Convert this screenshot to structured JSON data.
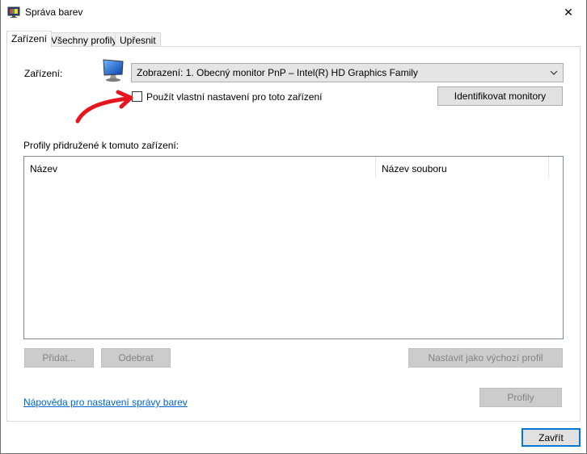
{
  "window": {
    "title": "Správa barev",
    "close_glyph": "✕"
  },
  "tabs": [
    {
      "label": "Zařízení",
      "active": true
    },
    {
      "label": "Všechny profily",
      "active": false
    },
    {
      "label": "Upřesnit",
      "active": false
    }
  ],
  "device": {
    "label": "Zařízení:",
    "selected": "Zobrazení: 1. Obecný monitor PnP – Intel(R) HD Graphics Family",
    "checkbox_label": "Použít vlastní nastavení pro toto zařízení",
    "checkbox_checked": false,
    "identify_button": "Identifikovat monitory"
  },
  "profiles": {
    "section_label": "Profily přidružené k tomuto zařízení:",
    "columns": [
      "Název",
      "Název souboru"
    ],
    "rows": []
  },
  "buttons": {
    "add": "Přidat...",
    "remove": "Odebrat",
    "set_default": "Nastavit jako výchozí profil",
    "profiles": "Profily",
    "close": "Zavřít"
  },
  "help_link": "Nápověda pro nastavení správy barev",
  "colors": {
    "accent": "#0078d7",
    "annotation": "#e8141e",
    "link": "#0066cc"
  },
  "icons": [
    "color-management-app-icon",
    "monitor-icon",
    "close-icon",
    "chevron-down-icon"
  ]
}
